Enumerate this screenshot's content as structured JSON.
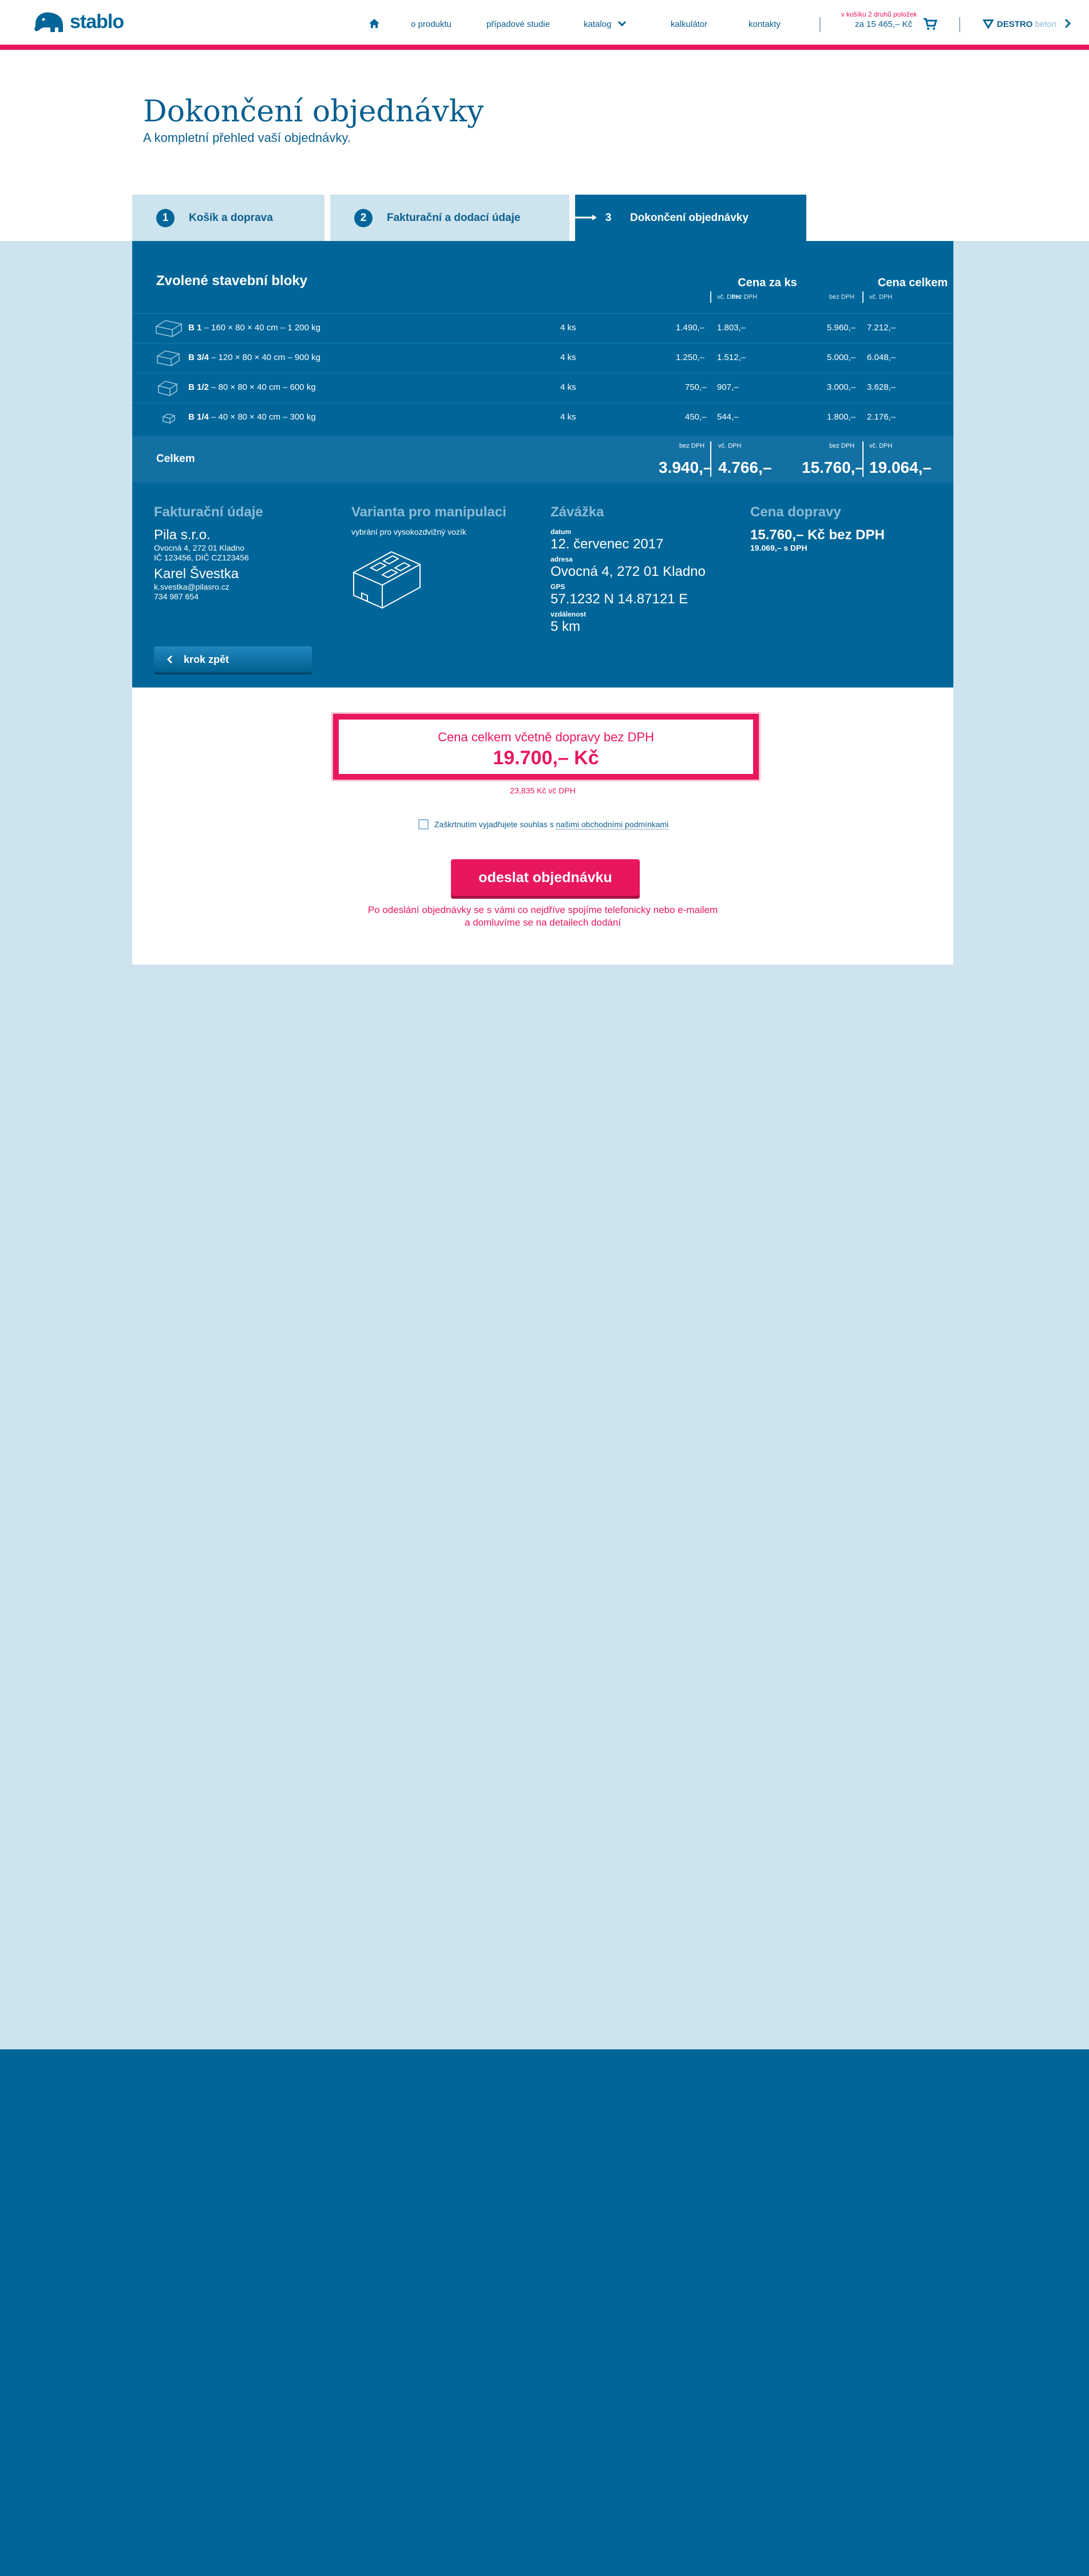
{
  "header": {
    "logo_text": "stablo",
    "nav": [
      "o produktu",
      "případové studie",
      "katalog",
      "kalkulátor",
      "kontakty"
    ],
    "cart_note": "v košíku 2 druhů položek",
    "cart_total": "za 15 465,– Kč",
    "brand_a": "DESTRO",
    "brand_b": "beton",
    "colors": {
      "accent": "#e8175d",
      "primary": "#006699"
    }
  },
  "page": {
    "title": "Dokončení objednávky",
    "subtitle": "A kompletní přehled vaší objednávky."
  },
  "steps": [
    {
      "num": "1",
      "label": "Košík a doprava"
    },
    {
      "num": "2",
      "label": "Fakturační a dodací údaje"
    },
    {
      "num": "3",
      "label": "Dokončení objednávky"
    }
  ],
  "blocks": {
    "title": "Zvolené stavební bloky",
    "col_unit": "Cena za ks",
    "col_total": "Cena celkem",
    "bez": "bez DPH",
    "vc": "vč. DPH",
    "rows": [
      {
        "code": "B 1",
        "desc": " – 160 × 80 × 40 cm – 1 200 kg",
        "qty": "4 ks",
        "u_bez": "1.490,–",
        "u_vc": "1.803,–",
        "t_bez": "5.960,–",
        "t_vc": "7.212,–"
      },
      {
        "code": "B 3/4",
        "desc": " – 120 × 80 × 40 cm – 900 kg",
        "qty": "4 ks",
        "u_bez": "1.250,–",
        "u_vc": "1.512,–",
        "t_bez": "5.000,–",
        "t_vc": "6.048,–"
      },
      {
        "code": "B 1/2",
        "desc": " – 80 × 80 × 40 cm – 600 kg",
        "qty": "4 ks",
        "u_bez": "750,–",
        "u_vc": "907,–",
        "t_bez": "3.000,–",
        "t_vc": "3.628,–"
      },
      {
        "code": "B 1/4",
        "desc": " – 40 × 80 × 40 cm – 300 kg",
        "qty": "4 ks",
        "u_bez": "450,–",
        "u_vc": "544,–",
        "t_bez": "1.800,–",
        "t_vc": "2.176,–"
      }
    ],
    "total_label": "Celkem",
    "total_u_bez": "3.940,–",
    "total_u_vc": "4.766,–",
    "total_t_bez": "15.760,–",
    "total_t_vc": "19.064,–"
  },
  "billing": {
    "heading": "Fakturační údaje",
    "company": "Pila s.r.o.",
    "address": "Ovocná 4, 272 01 Kladno",
    "ids": "IČ 123456, DIČ CZ123456",
    "person": "Karel Švestka",
    "email": "k.svestka@pilasro.cz",
    "phone": "734 987 654"
  },
  "handling": {
    "heading": "Varianta pro manipulaci",
    "text": "vybrání pro vysokozdvižný vozík"
  },
  "delivery": {
    "heading": "Závážka",
    "date_label": "datum",
    "date": "12. červenec 2017",
    "addr_label": "adresa",
    "addr": "Ovocná 4, 272 01 Kladno",
    "gps_label": "GPS",
    "gps": "57.1232 N 14.87121 E",
    "dist_label": "vzdálenost",
    "dist": "5 km"
  },
  "shipping": {
    "heading": "Cena dopravy",
    "price": "15.760,– Kč bez DPH",
    "vat": "19.069,– s DPH"
  },
  "back_label": "krok zpět",
  "summary": {
    "label": "Cena celkem včetně dopravy bez DPH",
    "value": "19.700,– Kč",
    "vat": "23,835 Kč vč DPH",
    "agree_text": "Zaškrtnutím vyjadřujete souhlas s ",
    "agree_link": "našimi obchodními podmínkami",
    "submit": "odeslat objednávku",
    "note_1": "Po odeslání objednávky se s vámi co nejdříve spojíme telefonicky nebo e-mailem",
    "note_2": "a domluvíme se na detailech dodání"
  }
}
